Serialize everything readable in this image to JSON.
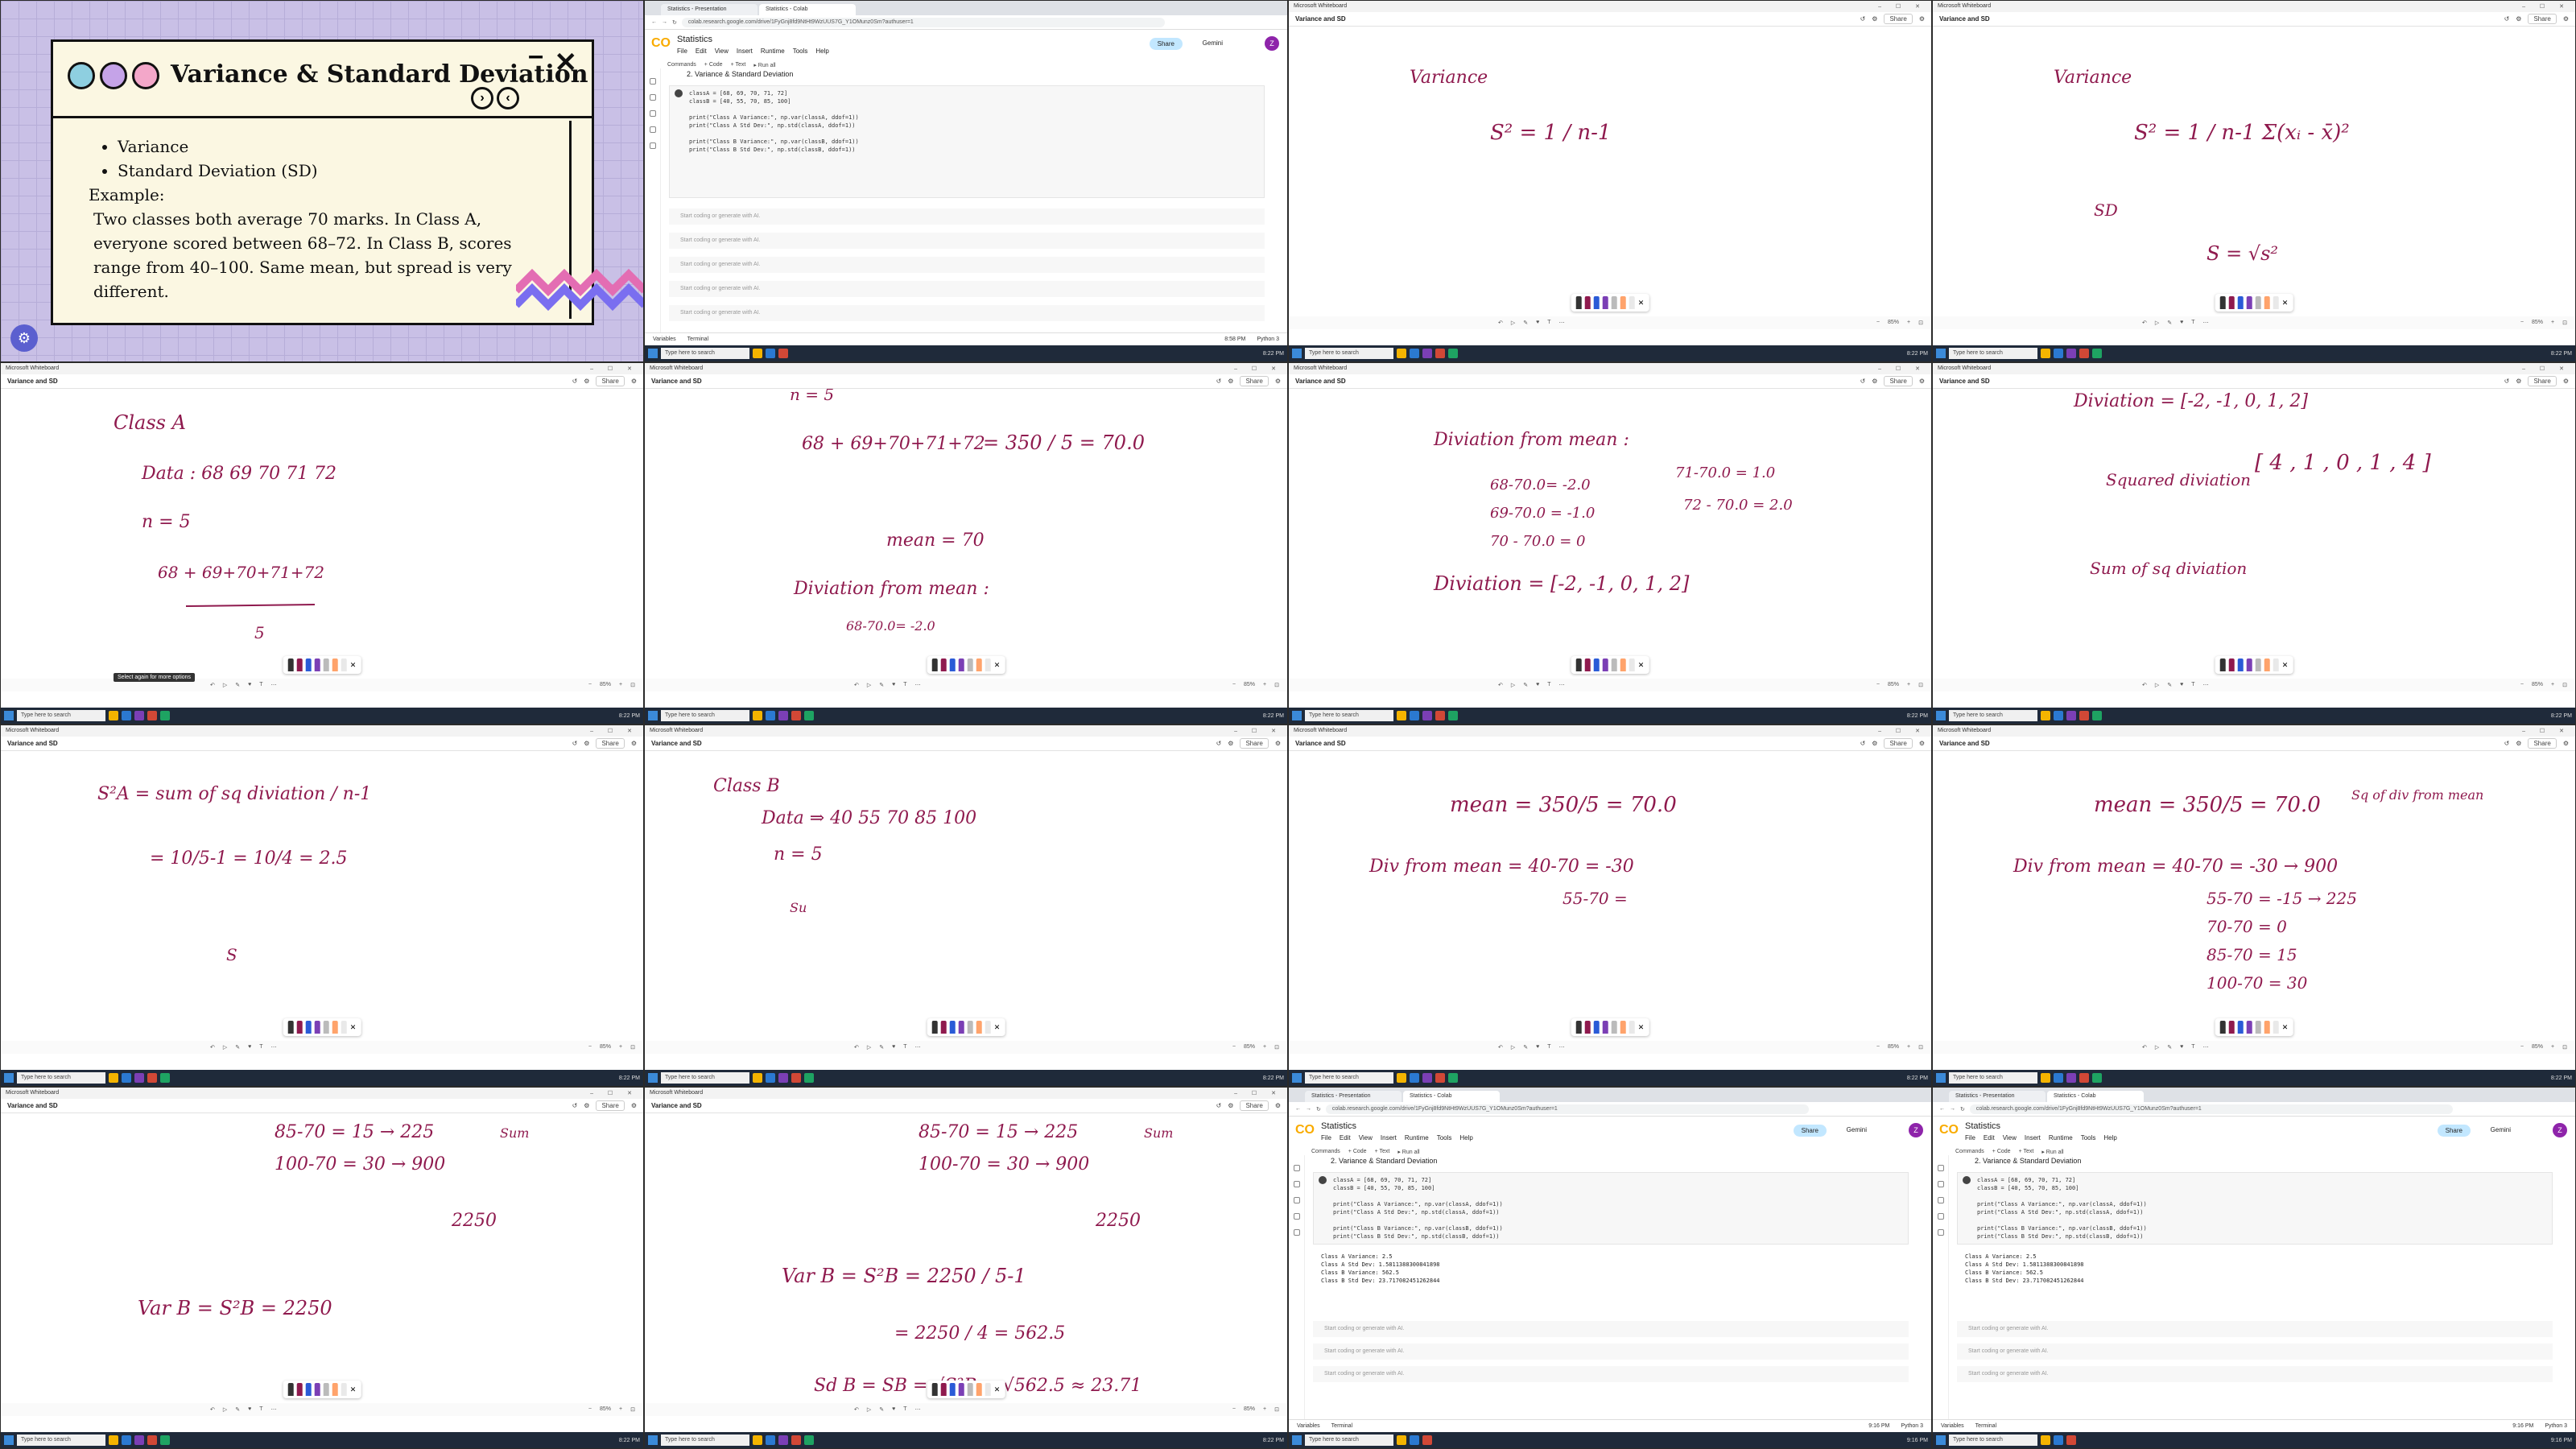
{
  "slide": {
    "title": "Variance & Standard Deviation",
    "bullets": [
      "Variance",
      "Standard Deviation (SD)"
    ],
    "example_label": "Example:",
    "example_text": "Two classes both average 70 marks. In Class A, everyone scored between 68–72. In Class B, scores range from 40–100. Same mean, but spread is very different."
  },
  "whiteboard": {
    "app_title": "Microsoft Whiteboard",
    "board_name": "Variance and SD",
    "share_label": "Share",
    "zoom": "85%",
    "tooltip": "Select again for more options"
  },
  "taskbar": {
    "search_placeholder": "Type here to search",
    "clock_a": "8:22 PM",
    "clock_b": "9:16 PM"
  },
  "colab": {
    "tab1": "Statistics - Presentation",
    "tab2": "Statistics - Colab",
    "url": "colab.research.google.com/drive/1FyGnj8fd9NtHt9WzUUS7G_Y1OMunz0Sm?authuser=1",
    "logo": "CO",
    "notebook": "Statistics",
    "menu": [
      "File",
      "Edit",
      "View",
      "Insert",
      "Runtime",
      "Tools",
      "Help"
    ],
    "tools": [
      "Commands",
      "+ Code",
      "+ Text",
      "▸ Run all"
    ],
    "share": "Share",
    "gemini": "Gemini",
    "avatar": "Z",
    "section": "2. Variance & Standard Deviation",
    "code": "classA = [68, 69, 70, 71, 72]\nclassB = [40, 55, 70, 85, 100]\n\nprint(\"Class A Variance:\", np.var(classA, ddof=1))\nprint(\"Class A Std Dev:\", np.std(classA, ddof=1))\n\nprint(\"Class B Variance:\", np.var(classB, ddof=1))\nprint(\"Class B Std Dev:\", np.std(classB, ddof=1))",
    "output": "Class A Variance: 2.5\nClass A Std Dev: 1.5811388300841898\nClass B Variance: 562.5\nClass B Std Dev: 23.717082451262844",
    "empty_cell": "Start coding or generate with AI.",
    "status_left": [
      "Variables",
      "Terminal"
    ],
    "status_time_a": "8:58 PM",
    "status_time_b": "9:16 PM",
    "runtime": "Python 3"
  },
  "notes": {
    "n1": {
      "title": "Variance",
      "f1": "S² = 1 / n-1"
    },
    "n2": {
      "title": "Variance",
      "f1": "S² = 1 / n-1  Σ(xᵢ - x̄)²",
      "sd": "SD",
      "f2": "S = √s²"
    },
    "n3": {
      "title": "Class A",
      "data": "Data  :  68  69  70  71  72",
      "n": "n = 5",
      "sum": "68 + 69+70+71+72",
      "den": "5"
    },
    "n4": {
      "top": "n = 5",
      "sum": "68 + 69+70+71+72",
      "eq": "= 350 / 5 = 70.0",
      "mean": "mean = 70",
      "dev": "Diviation from mean :",
      "d1": "68-70.0= -2.0"
    },
    "n5": {
      "dev": "Diviation from mean :",
      "l1": "68-70.0= -2.0",
      "l2": "69-70.0 = -1.0",
      "l3": "70 - 70.0 = 0",
      "l4": "71-70.0 = 1.0",
      "l5": "72 - 70.0 = 2.0",
      "res": "Diviation  =  [-2, -1, 0, 1, 2]"
    },
    "n6": {
      "top": "Diviation  =  [-2, -1, 0, 1, 2]",
      "sq": "Squared diviation",
      "sqv": "[ 4 , 1 , 0 , 1 , 4 ]",
      "sum": "Sum of sq diviation"
    },
    "n7": {
      "f": "S²A = sum of sq diviation / n-1",
      "calc": "= 10/5-1 = 10/4 = 2.5",
      "s": "S"
    },
    "n8": {
      "title": "Class B",
      "data": "Data  ⇒  40   55   70   85   100",
      "n": "n   =  5",
      "su": "Su"
    },
    "n9": {
      "mean": "mean = 350/5 = 70.0",
      "div": "Div from mean  =  40-70 = -30",
      "l2": "55-70 ="
    },
    "n10": {
      "mean": "mean = 350/5 = 70.0",
      "hdr": "Sq of div from mean",
      "div": "Div from mean  =  40-70 = -30  → 900",
      "l2": "55-70 = -15  → 225",
      "l3": "70-70 = 0",
      "l4": "85-70 = 15",
      "l5": "100-70 = 30"
    },
    "n11": {
      "l1": "85-70 = 15  → 225",
      "l2": "100-70 = 30  → 900",
      "tot": "2250",
      "sum": "Sum",
      "var": "Var B = S²B = 2250"
    },
    "n12": {
      "l1": "85-70 = 15  → 225",
      "l2": "100-70 = 30  → 900",
      "tot": "2250",
      "sum": "Sum",
      "var": "Var B = S²B = 2250 / 5-1",
      "calc": "= 2250 / 4 = 562.5",
      "sd": "Sd B = SB = √S²B = √562.5 ≈ 23.71"
    }
  }
}
